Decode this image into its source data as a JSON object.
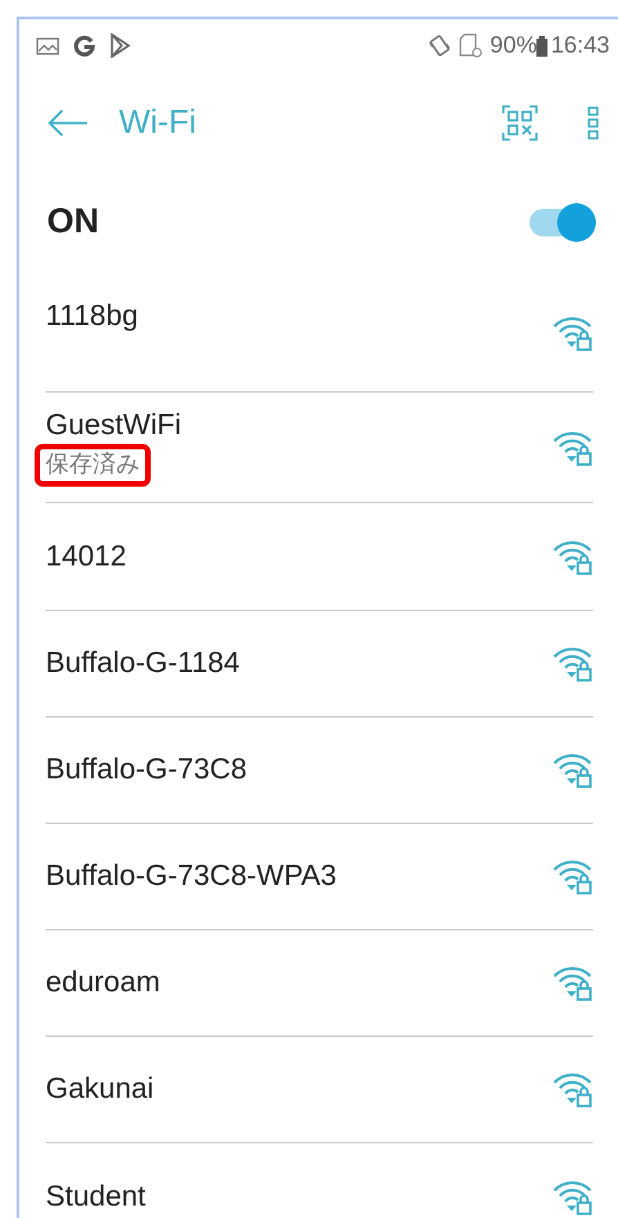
{
  "status_bar": {
    "battery": "90%",
    "time": "16:43"
  },
  "app_bar": {
    "title": "Wi-Fi"
  },
  "master_switch": {
    "label": "ON",
    "on": true
  },
  "networks": [
    {
      "name": "1118bg",
      "locked": true
    },
    {
      "name": "GuestWiFi",
      "subtitle": "保存済み",
      "highlighted": true,
      "locked": true
    },
    {
      "name": "14012",
      "locked": true
    },
    {
      "name": "Buffalo-G-1184",
      "locked": true
    },
    {
      "name": "Buffalo-G-73C8",
      "locked": true
    },
    {
      "name": "Buffalo-G-73C8-WPA3",
      "locked": true
    },
    {
      "name": "eduroam",
      "locked": true
    },
    {
      "name": "Gakunai",
      "locked": true
    },
    {
      "name": "Student",
      "locked": true
    }
  ]
}
